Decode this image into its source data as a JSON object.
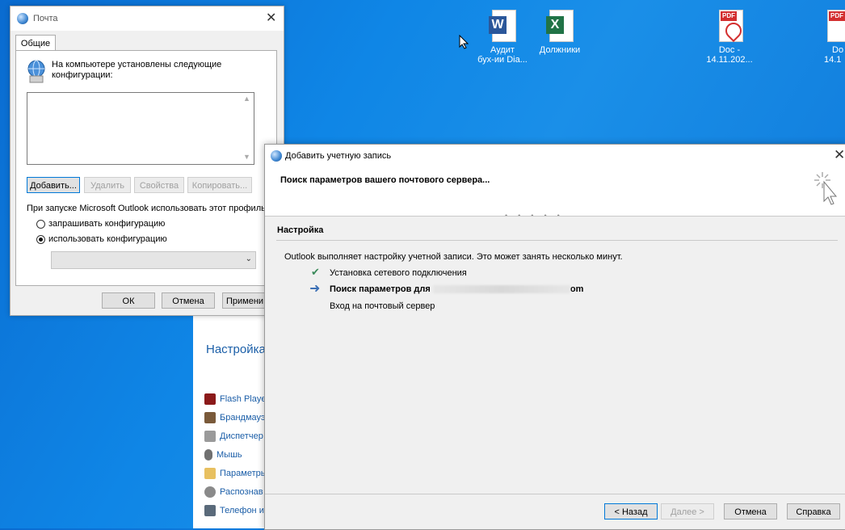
{
  "desktop": {
    "icons": [
      {
        "label_line1": "Аудит",
        "label_line2": "бух-ии Dia...",
        "type": "word"
      },
      {
        "label_line1": "Должники",
        "label_line2": "",
        "type": "excel"
      },
      {
        "label_line1": "Doc -",
        "label_line2": "14.11.202...",
        "type": "pdf"
      },
      {
        "label_line1": "Do",
        "label_line2": "14.1",
        "type": "pdf"
      }
    ],
    "icon_letters": {
      "word": "W",
      "excel": "X",
      "pdf": "PDF"
    }
  },
  "control_panel": {
    "title": "Настройка",
    "items": [
      "Flash Playe",
      "Брандмауэ",
      "Диспетчер",
      "Мышь",
      "Параметры",
      "Распознав",
      "Телефон и"
    ]
  },
  "mail_dialog": {
    "title": "Почта",
    "tab": "Общие",
    "intro": "На компьютере установлены следующие конфигурации:",
    "buttons": {
      "add": "Добавить...",
      "delete": "Удалить",
      "properties": "Свойства",
      "copy": "Копировать..."
    },
    "startup_label": "При запуске Microsoft Outlook использовать этот профиль",
    "radio_ask": "запрашивать конфигурацию",
    "radio_use": "использовать конфигурацию",
    "ok": "ОК",
    "cancel": "Отмена",
    "apply": "Примени"
  },
  "add_account": {
    "title": "Добавить учетную запись",
    "header": "Поиск параметров вашего почтового сервера...",
    "section": "Настройка",
    "description": "Outlook выполняет настройку учетной записи. Это может занять несколько минут.",
    "steps": [
      {
        "label": "Установка сетевого подключения",
        "status": "done"
      },
      {
        "label": "Поиск параметров для",
        "suffix": "om",
        "status": "current"
      },
      {
        "label": "Вход на почтовый сервер",
        "status": "pending"
      }
    ],
    "buttons": {
      "back": "< Назад",
      "next": "Далее >",
      "cancel": "Отмена",
      "help": "Справка"
    }
  },
  "colors": {
    "accent": "#0078d7",
    "desktop": "#0f86e6",
    "check": "#3a8a5a",
    "arrow": "#3b6fb5"
  }
}
